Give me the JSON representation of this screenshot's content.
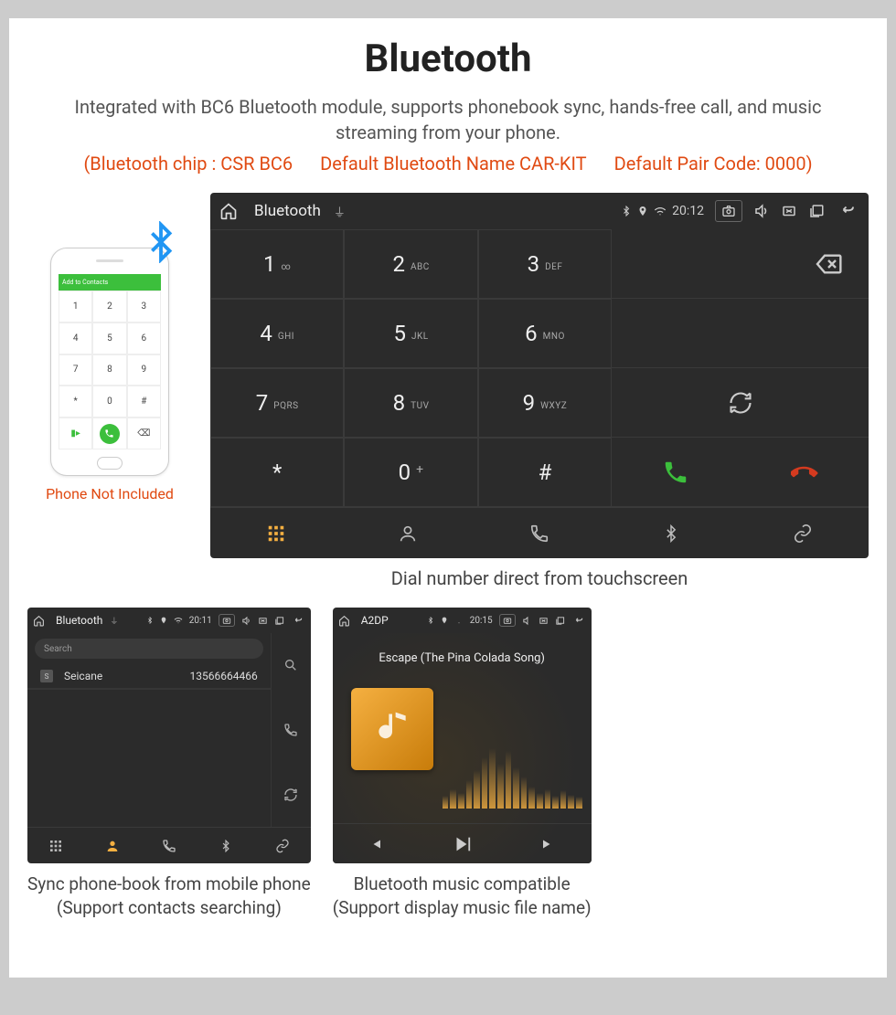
{
  "header": {
    "title": "Bluetooth",
    "subtitle": "Integrated with BC6 Bluetooth module, supports phonebook sync, hands-free call, and music streaming from your phone.",
    "spec_chip": "(Bluetooth chip : CSR BC6",
    "spec_name": "Default Bluetooth Name CAR-KIT",
    "spec_pair": "Default Pair Code: 0000)"
  },
  "phone": {
    "add_contacts": "Add to Contacts",
    "keys": [
      "1",
      "2",
      "3",
      "4",
      "5",
      "6",
      "7",
      "8",
      "9",
      "*",
      "0",
      "#"
    ],
    "caption": "Phone Not Included"
  },
  "dialer": {
    "status": {
      "app": "Bluetooth",
      "time": "20:12"
    },
    "keys": [
      {
        "d": "1",
        "s": "∞"
      },
      {
        "d": "2",
        "s": "ABC"
      },
      {
        "d": "3",
        "s": "DEF"
      },
      {
        "d": "4",
        "s": "GHI"
      },
      {
        "d": "5",
        "s": "JKL"
      },
      {
        "d": "6",
        "s": "MNO"
      },
      {
        "d": "7",
        "s": "PQRS"
      },
      {
        "d": "8",
        "s": "TUV"
      },
      {
        "d": "9",
        "s": "WXYZ"
      },
      {
        "d": "*",
        "s": ""
      },
      {
        "d": "0",
        "s": "+"
      },
      {
        "d": "#",
        "s": ""
      }
    ],
    "caption": "Dial number direct from touchscreen"
  },
  "phonebook": {
    "status": {
      "app": "Bluetooth",
      "time": "20:11"
    },
    "search_placeholder": "Search",
    "contact": {
      "name": "Seicane",
      "number": "13566664466"
    },
    "caption_line1": "Sync phone-book from mobile phone",
    "caption_line2": "(Support contacts searching)"
  },
  "a2dp": {
    "status": {
      "app": "A2DP",
      "time": "20:15"
    },
    "track": "Escape (The Pina Colada Song)",
    "caption_line1": "Bluetooth music compatible",
    "caption_line2": "(Support display music file name)"
  }
}
